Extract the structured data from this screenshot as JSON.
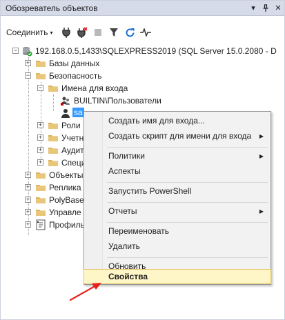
{
  "window": {
    "title": "Обозреватель объектов",
    "pin_glyph": "▾",
    "dock_glyph": "⊥",
    "close_glyph": "✕"
  },
  "toolbar": {
    "connect_label": "Соединить",
    "connect_caret": "▾",
    "icons": [
      "connect-plug-icon",
      "disconnect-plug-icon",
      "stop-icon",
      "filter-icon",
      "refresh-icon",
      "activity-monitor-icon"
    ]
  },
  "tree": {
    "server": "192.168.0.5,1433\\SQLEXPRESS2019 (SQL Server 15.0.2080 - D",
    "databases": "Базы данных",
    "security": "Безопасность",
    "logins": "Имена для входа",
    "login_builtin": "BUILTIN\\Пользователи",
    "login_sa": "sa",
    "roles": "Роли",
    "credentials": "Учетн",
    "audits": "Аудит",
    "specs": "Специ",
    "server_objects": "Объекты",
    "replication": "Реплика",
    "polybase": "PolyBase",
    "management": "Управле",
    "profiler": "Профиль",
    "expand_plus": "+",
    "expand_minus": "−"
  },
  "context_menu": {
    "items": [
      {
        "label": "Создать имя для входа...",
        "submenu": false
      },
      {
        "label": "Создать скрипт для имени для входа",
        "submenu": true
      },
      {
        "label": "Политики",
        "submenu": true
      },
      {
        "label": "Аспекты",
        "submenu": false
      },
      {
        "label": "Запустить PowerShell",
        "submenu": false
      },
      {
        "label": "Отчеты",
        "submenu": true
      },
      {
        "label": "Переименовать",
        "submenu": false
      },
      {
        "label": "Удалить",
        "submenu": false
      },
      {
        "label": "Обновить",
        "submenu": false
      },
      {
        "label": "Свойства",
        "submenu": false
      }
    ],
    "submenu_arrow": "▶",
    "highlighted": "Свойства"
  },
  "colors": {
    "titlebar": "#d6dbe9",
    "selection": "#3399ff",
    "highlight_bg": "#fff6c8",
    "highlight_border": "#e5c365",
    "annotation_arrow": "#e8211b",
    "folder": "#dcb35c"
  }
}
